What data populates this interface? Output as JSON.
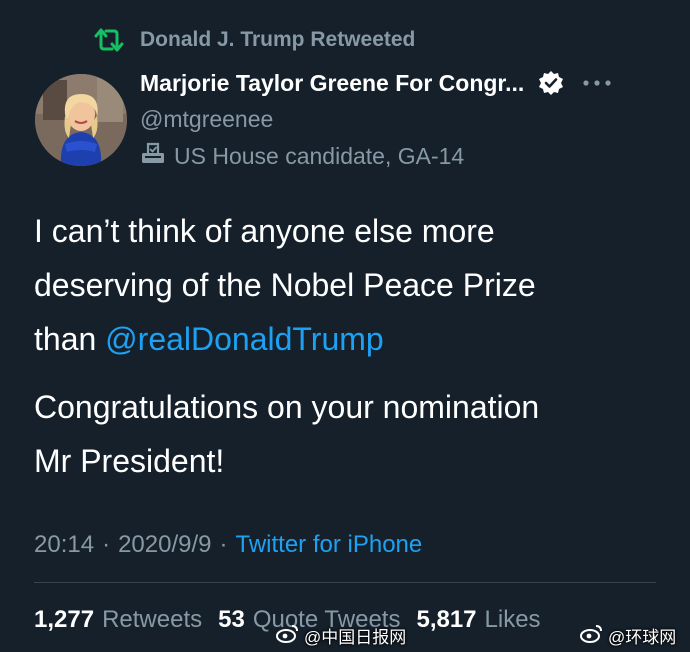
{
  "retweet": {
    "label": "Donald J. Trump Retweeted",
    "icon": "retweet-icon"
  },
  "author": {
    "display_name": "Marjorie Taylor Greene For Congr...",
    "handle": "@mtgreenee",
    "candidate_label": "US House candidate, GA-14",
    "verified_icon": "verified-badge-icon",
    "more_icon": "more-options-icon",
    "ballot_icon": "ballot-box-icon"
  },
  "tweet": {
    "line1": "I can’t think of anyone else more",
    "line2": "deserving of the Nobel Peace Prize",
    "line3_prefix": "than ",
    "mention": "@realDonaldTrump",
    "para2_line1": "Congratulations on your nomination",
    "para2_line2": "Mr President!"
  },
  "meta": {
    "time": "20:14",
    "separator": "·",
    "date": "2020/9/9",
    "source": "Twitter for iPhone"
  },
  "stats": {
    "retweets_count": "1,277",
    "retweets_label": "Retweets",
    "quotes_count": "53",
    "quotes_label": "Quote Tweets",
    "likes_count": "5,817",
    "likes_label": "Likes"
  },
  "watermarks": {
    "left": "@中国日报网",
    "right": "@环球网",
    "icon": "weibo-logo-icon"
  },
  "colors": {
    "background": "#15202b",
    "muted": "#8899a6",
    "accent": "#1da1f2",
    "retweet_green": "#17bf63",
    "divider": "#38444d"
  }
}
